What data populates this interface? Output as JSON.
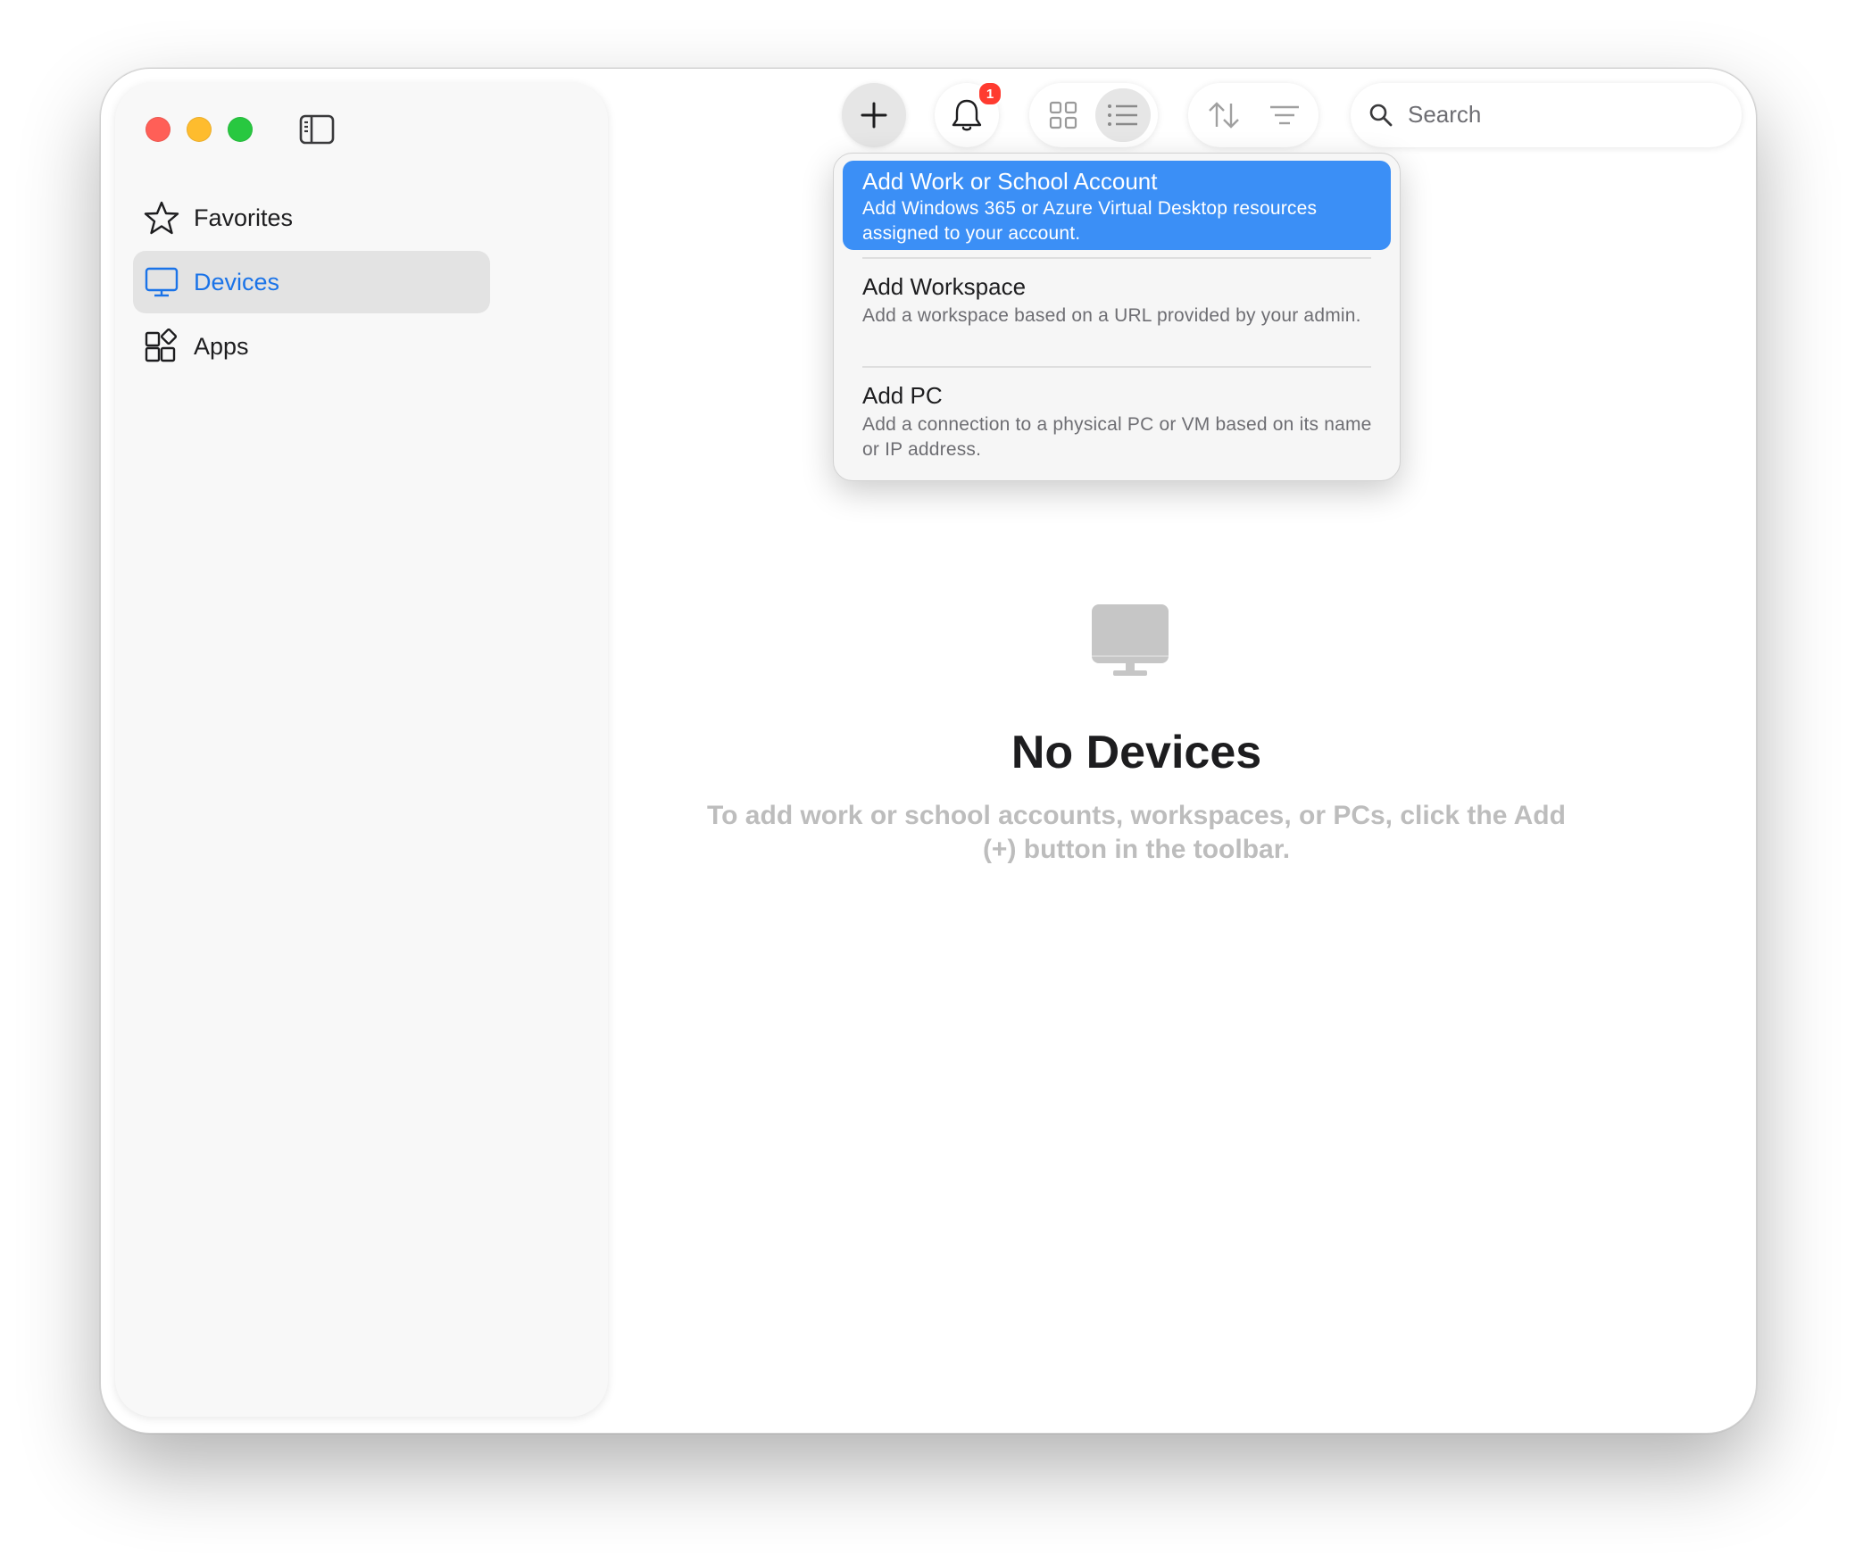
{
  "sidebar": {
    "items": [
      {
        "label": "Favorites",
        "icon": "star-icon"
      },
      {
        "label": "Devices",
        "icon": "monitor-icon"
      },
      {
        "label": "Apps",
        "icon": "apps-icon"
      }
    ],
    "selected": "Devices"
  },
  "toolbar": {
    "notification_count": "1",
    "search_placeholder": "Search"
  },
  "add_menu": {
    "items": [
      {
        "title": "Add Work or School Account",
        "description": "Add Windows 365 or Azure Virtual Desktop resources assigned to your account."
      },
      {
        "title": "Add Workspace",
        "description": "Add a workspace based on a URL provided by your admin."
      },
      {
        "title": "Add PC",
        "description": "Add a connection to a physical PC or VM based on its name or IP address."
      }
    ]
  },
  "empty_state": {
    "title": "No Devices",
    "message": "To add work or school accounts, workspaces, or PCs, click the Add (+) button in the toolbar."
  },
  "colors": {
    "accent": "#1a73e8",
    "menu_highlight": "#3b8ff6",
    "badge": "#ff3b30"
  }
}
